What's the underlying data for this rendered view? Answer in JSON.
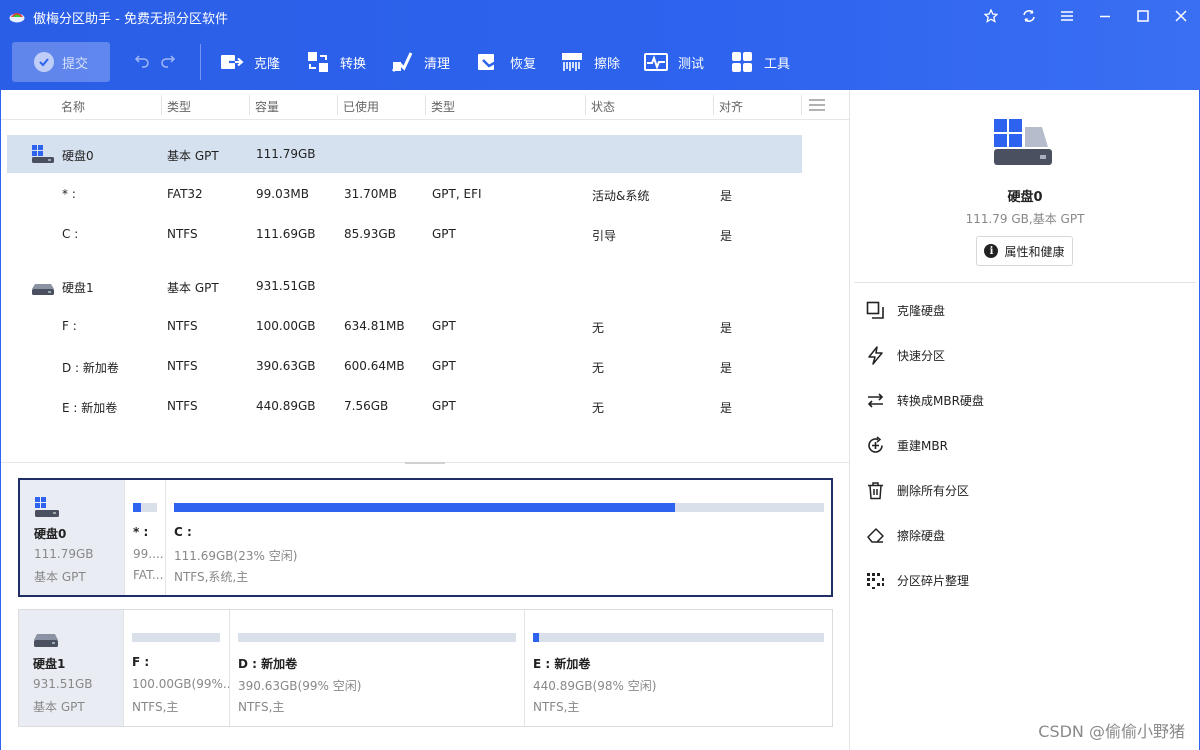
{
  "app": {
    "title": "傲梅分区助手 - 免费无损分区软件"
  },
  "toolbar": {
    "submit_label": "提交",
    "items": [
      {
        "label": "克隆",
        "icon": "clone-icon"
      },
      {
        "label": "转换",
        "icon": "convert-icon"
      },
      {
        "label": "清理",
        "icon": "cleanup-icon"
      },
      {
        "label": "恢复",
        "icon": "recover-icon"
      },
      {
        "label": "擦除",
        "icon": "wipe-icon"
      },
      {
        "label": "测试",
        "icon": "test-icon"
      },
      {
        "label": "工具",
        "icon": "tools-icon"
      }
    ]
  },
  "columns": [
    "名称",
    "类型",
    "容量",
    "已使用",
    "类型",
    "状态",
    "对齐"
  ],
  "rows": [
    {
      "name": "硬盘0",
      "type": "基本 GPT",
      "capacity": "111.79GB",
      "used": "",
      "fs_type": "",
      "status": "",
      "align": ""
    },
    {
      "name": "* :",
      "type": "FAT32",
      "capacity": "99.03MB",
      "used": "31.70MB",
      "fs_type": "GPT, EFI",
      "status": "活动&系统",
      "align": "是"
    },
    {
      "name": "C :",
      "type": "NTFS",
      "capacity": "111.69GB",
      "used": "85.93GB",
      "fs_type": "GPT",
      "status": "引导",
      "align": "是"
    },
    {
      "name": "硬盘1",
      "type": "基本 GPT",
      "capacity": "931.51GB",
      "used": "",
      "fs_type": "",
      "status": "",
      "align": ""
    },
    {
      "name": "F :",
      "type": "NTFS",
      "capacity": "100.00GB",
      "used": "634.81MB",
      "fs_type": "GPT",
      "status": "无",
      "align": "是"
    },
    {
      "name": "D : 新加卷",
      "type": "NTFS",
      "capacity": "390.63GB",
      "used": "600.64MB",
      "fs_type": "GPT",
      "status": "无",
      "align": "是"
    },
    {
      "name": "E : 新加卷",
      "type": "NTFS",
      "capacity": "440.89GB",
      "used": "7.56GB",
      "fs_type": "GPT",
      "status": "无",
      "align": "是"
    }
  ],
  "disk_map": [
    {
      "name": "硬盘0",
      "size": "111.79GB",
      "type": "基本 GPT",
      "partitions": [
        {
          "name": "* :",
          "size": "99....",
          "type": "FAT...",
          "used_fraction": 0.32
        },
        {
          "name": "C :",
          "size": "111.69GB(23% 空闲)",
          "type": "NTFS,系统,主",
          "used_fraction": 0.77
        }
      ]
    },
    {
      "name": "硬盘1",
      "size": "931.51GB",
      "type": "基本 GPT",
      "partitions": [
        {
          "name": "F :",
          "size": "100.00GB(99%...",
          "type": "NTFS,主",
          "used_fraction": 0.0
        },
        {
          "name": "D : 新加卷",
          "size": "390.63GB(99% 空闲)",
          "type": "NTFS,主",
          "used_fraction": 0.0
        },
        {
          "name": "E : 新加卷",
          "size": "440.89GB(98% 空闲)",
          "type": "NTFS,主",
          "used_fraction": 0.02
        }
      ]
    }
  ],
  "right_panel": {
    "disk_name": "硬盘0",
    "disk_info": "111.79 GB,基本 GPT",
    "properties_label": "属性和健康",
    "operations": [
      {
        "label": "克隆硬盘",
        "icon": "clone-disk-icon"
      },
      {
        "label": "快速分区",
        "icon": "lightning-icon"
      },
      {
        "label": "转换成MBR硬盘",
        "icon": "convert-arrows-icon"
      },
      {
        "label": "重建MBR",
        "icon": "rebuild-icon"
      },
      {
        "label": "删除所有分区",
        "icon": "trash-icon"
      },
      {
        "label": "擦除硬盘",
        "icon": "eraser-icon"
      },
      {
        "label": "分区碎片整理",
        "icon": "defrag-icon"
      }
    ]
  },
  "watermark": "CSDN @偷偷小野猪",
  "colors": {
    "accent": "#2d63ee",
    "selected_row": "#d6e1ef",
    "card_active_border": "#1f2e66"
  }
}
